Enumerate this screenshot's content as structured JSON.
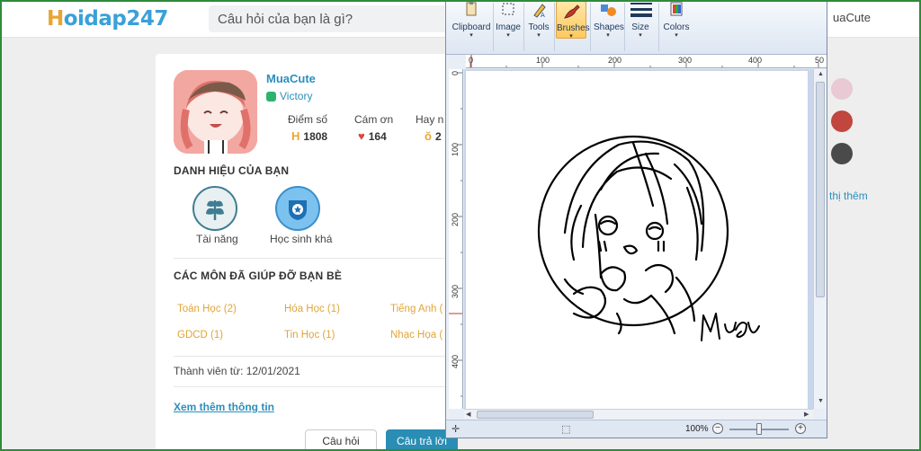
{
  "site": {
    "logo": "Hoidap247",
    "search_placeholder": "Câu hỏi của bạn là gì?",
    "header_user": "uaCute"
  },
  "profile": {
    "username": "MuaCute",
    "rank": "Victory",
    "stats": [
      {
        "label": "Điểm số",
        "value": "1808",
        "icon": "h-points-icon"
      },
      {
        "label": "Cám ơn",
        "value": "164",
        "icon": "heart-icon"
      },
      {
        "label": "Hay n",
        "value": "2",
        "icon": "medal-icon"
      }
    ],
    "badges_title": "DANH HIỆU CỦA BẠN",
    "badges": [
      {
        "label": "Tài năng",
        "icon": "leaf-badge-icon"
      },
      {
        "label": "Học sinh khá",
        "icon": "star-badge-icon"
      }
    ],
    "subjects_title": "CÁC MÔN ĐÃ GIÚP ĐỠ BẠN BÈ",
    "subjects": [
      "Toán Học (2)",
      "Hóa Học (1)",
      "Tiếng Anh (",
      "GDCD (1)",
      "Tin Học (1)",
      "Nhạc Họa ("
    ],
    "member_since": "Thành viên từ: 12/01/2021",
    "more_info": "Xem thêm thông tin",
    "tabs": {
      "question": "Câu hỏi",
      "answer": "Câu trả lời"
    }
  },
  "right_panel": {
    "show_more": "n thị thêm"
  },
  "paint": {
    "ribbon": [
      {
        "label": "Clipboard",
        "icon": "clipboard-icon"
      },
      {
        "label": "Image",
        "icon": "select-icon"
      },
      {
        "label": "Tools",
        "icon": "pencil-icon"
      },
      {
        "label": "Brushes",
        "icon": "brush-icon"
      },
      {
        "label": "Shapes",
        "icon": "shapes-icon"
      },
      {
        "label": "Size",
        "icon": "size-icon"
      },
      {
        "label": "Colors",
        "icon": "colors-icon"
      }
    ],
    "ruler_top": [
      "0",
      "100",
      "200",
      "300",
      "400",
      "50"
    ],
    "ruler_left": [
      "0",
      "100",
      "200",
      "300",
      "400"
    ],
    "zoom": "100%",
    "signature": "Mua"
  },
  "colors": {
    "accent_blue": "#2b8fbd",
    "subject_orange": "#e0a53a",
    "frame_green": "#2e8b3a"
  }
}
